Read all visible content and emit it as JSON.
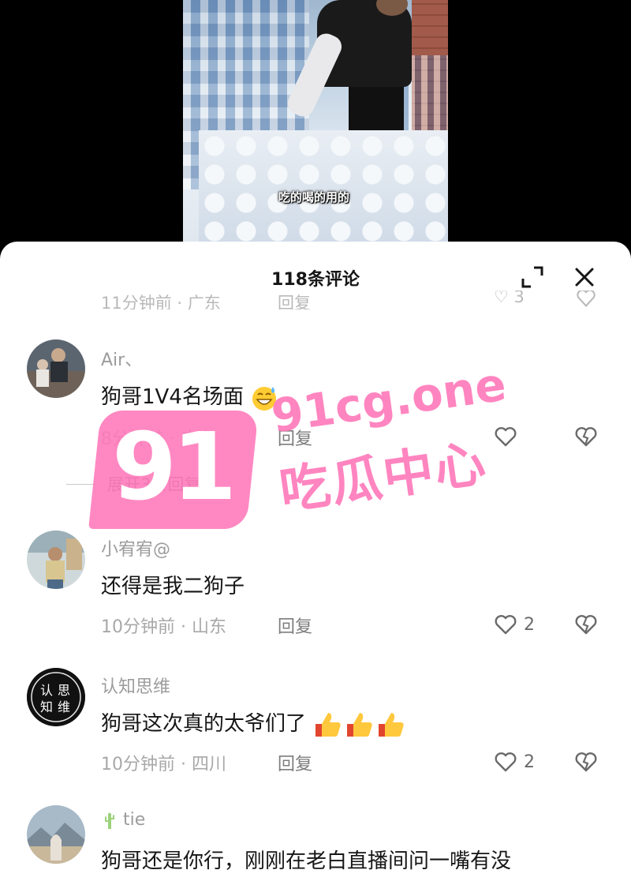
{
  "video": {
    "subtitle": "吃的喝的用的"
  },
  "sheet": {
    "title": "118条评论",
    "clipped_row": {
      "meta": "11分钟前 · 广东",
      "reply": "回复",
      "likes": "3"
    }
  },
  "comments": [
    {
      "username": "Air、",
      "text": "狗哥1V4名场面",
      "emoji": "grinning-sweat-emoji",
      "time_location": "8分钟前 · 广东",
      "reply": "回复",
      "likes": "",
      "expand_replies": "展开3条回复"
    },
    {
      "username": "小宥宥@",
      "text": "还得是我二狗子",
      "time_location": "10分钟前 · 山东",
      "reply": "回复",
      "likes": "2"
    },
    {
      "username": "认知思维",
      "avatar_text": [
        "认",
        "思",
        "知",
        "维"
      ],
      "text": "狗哥这次真的太爷们了",
      "emoji": "thumbs-up-emoji",
      "time_location": "10分钟前 · 四川",
      "reply": "回复",
      "likes": "2"
    },
    {
      "username": "tie",
      "text": "狗哥还是你行，刚刚在老白直播间问一嘴有没"
    }
  ],
  "watermark": {
    "number": "91",
    "site": "91cg.one",
    "name": "吃瓜中心"
  },
  "colors": {
    "watermark_pink": "#ff78b9",
    "sheet_bg": "#ffffff",
    "muted_text": "#a8a8a8"
  }
}
